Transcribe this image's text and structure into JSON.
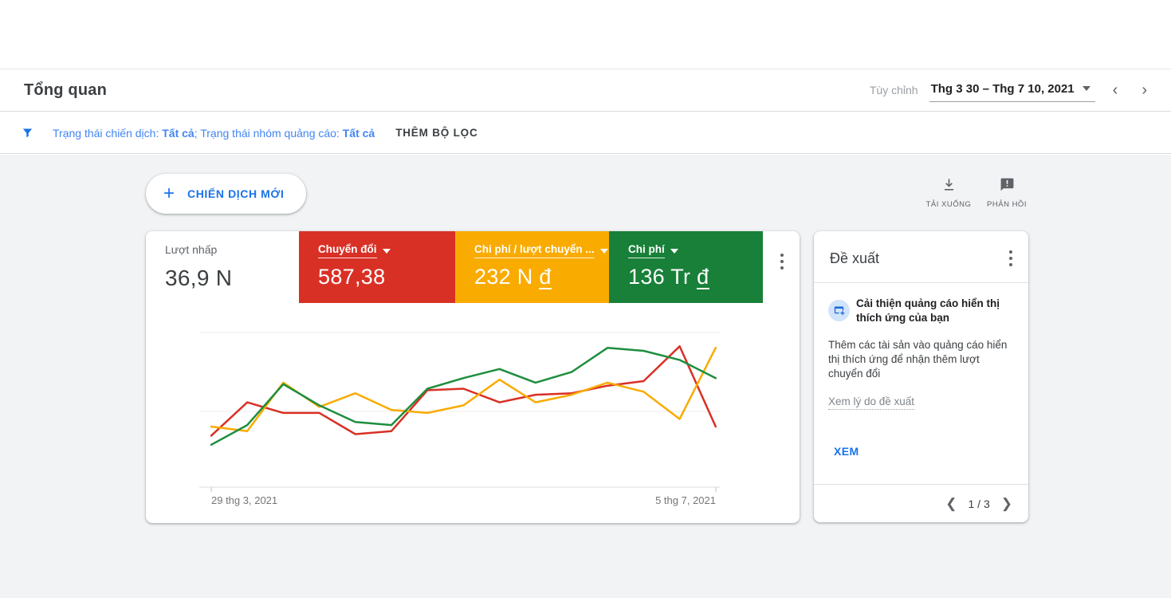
{
  "header": {
    "title": "Tổng quan",
    "date_custom_label": "Tùy chỉnh",
    "date_range": "Thg 3 30 – Thg 7 10, 2021"
  },
  "filters": {
    "campaign_status_label": "Trạng thái chiến dịch:",
    "campaign_status_value": "Tất cả",
    "separator": ";",
    "adgroup_status_label": "Trạng thái nhóm quảng cáo:",
    "adgroup_status_value": "Tất cả",
    "add_filter_label": "THÊM BỘ LỌC"
  },
  "toolbar": {
    "new_campaign_label": "CHIẾN DỊCH MỚI",
    "plus_glyph": "+",
    "download_label": "TẢI XUỐNG",
    "feedback_label": "PHẢN HỒI"
  },
  "scorecards": [
    {
      "label": "Lượt nhấp",
      "value": "36,9 N",
      "currency": "",
      "color": "#ffffff",
      "selected": false
    },
    {
      "label": "Chuyển đổi",
      "value": "587,38",
      "currency": "",
      "color": "#d93025",
      "selected": true
    },
    {
      "label": "Chi phí / lượt chuyển ...",
      "value": "232 N",
      "currency": "đ",
      "color": "#f9ab00",
      "selected": true
    },
    {
      "label": "Chi phí",
      "value": "136 Tr",
      "currency": "đ",
      "color": "#188038",
      "selected": true
    }
  ],
  "chart_data": {
    "type": "line",
    "x_axis": {
      "start_label": "29 thg 3, 2021",
      "end_label": "5 thg 7, 2021",
      "num_points": 15,
      "unit": "weeks"
    },
    "y_axis": {
      "scale": "relative 0-100 (unlabeled)",
      "gridlines_at": [
        0,
        50,
        102
      ],
      "grid": true
    },
    "legend": "none (line colors match scorecards)",
    "series": [
      {
        "id": "chuyen-doi",
        "name": "Chuyển đổi",
        "color": "#d93025",
        "values": [
          34,
          56,
          49,
          49,
          35,
          37,
          64,
          65,
          56,
          61,
          62,
          67,
          70,
          93,
          40
        ]
      },
      {
        "id": "chi-phi-luot-chuyen-doi",
        "name": "Chi phí / lượt chuyển đổi",
        "color": "#f9ab00",
        "values": [
          40,
          37,
          69,
          53,
          62,
          51,
          49,
          54,
          71,
          56,
          61,
          69,
          63,
          45,
          92
        ]
      },
      {
        "id": "chi-phi",
        "name": "Chi phí",
        "color": "#1e8e3e",
        "values": [
          28,
          41,
          68,
          54,
          43,
          41,
          65,
          72,
          78,
          69,
          76,
          92,
          90,
          84,
          72
        ]
      }
    ]
  },
  "suggestions": {
    "title": "Đề xuất",
    "card_title": "Cải thiện quảng cáo hiển thị thích ứng của bạn",
    "card_body": "Thêm các tài sản vào quảng cáo hiển thị thích ứng để nhận thêm lượt chuyển đổi",
    "reason_link": "Xem lý do đề xuất",
    "action_label": "XEM",
    "pagination": "1 / 3"
  }
}
